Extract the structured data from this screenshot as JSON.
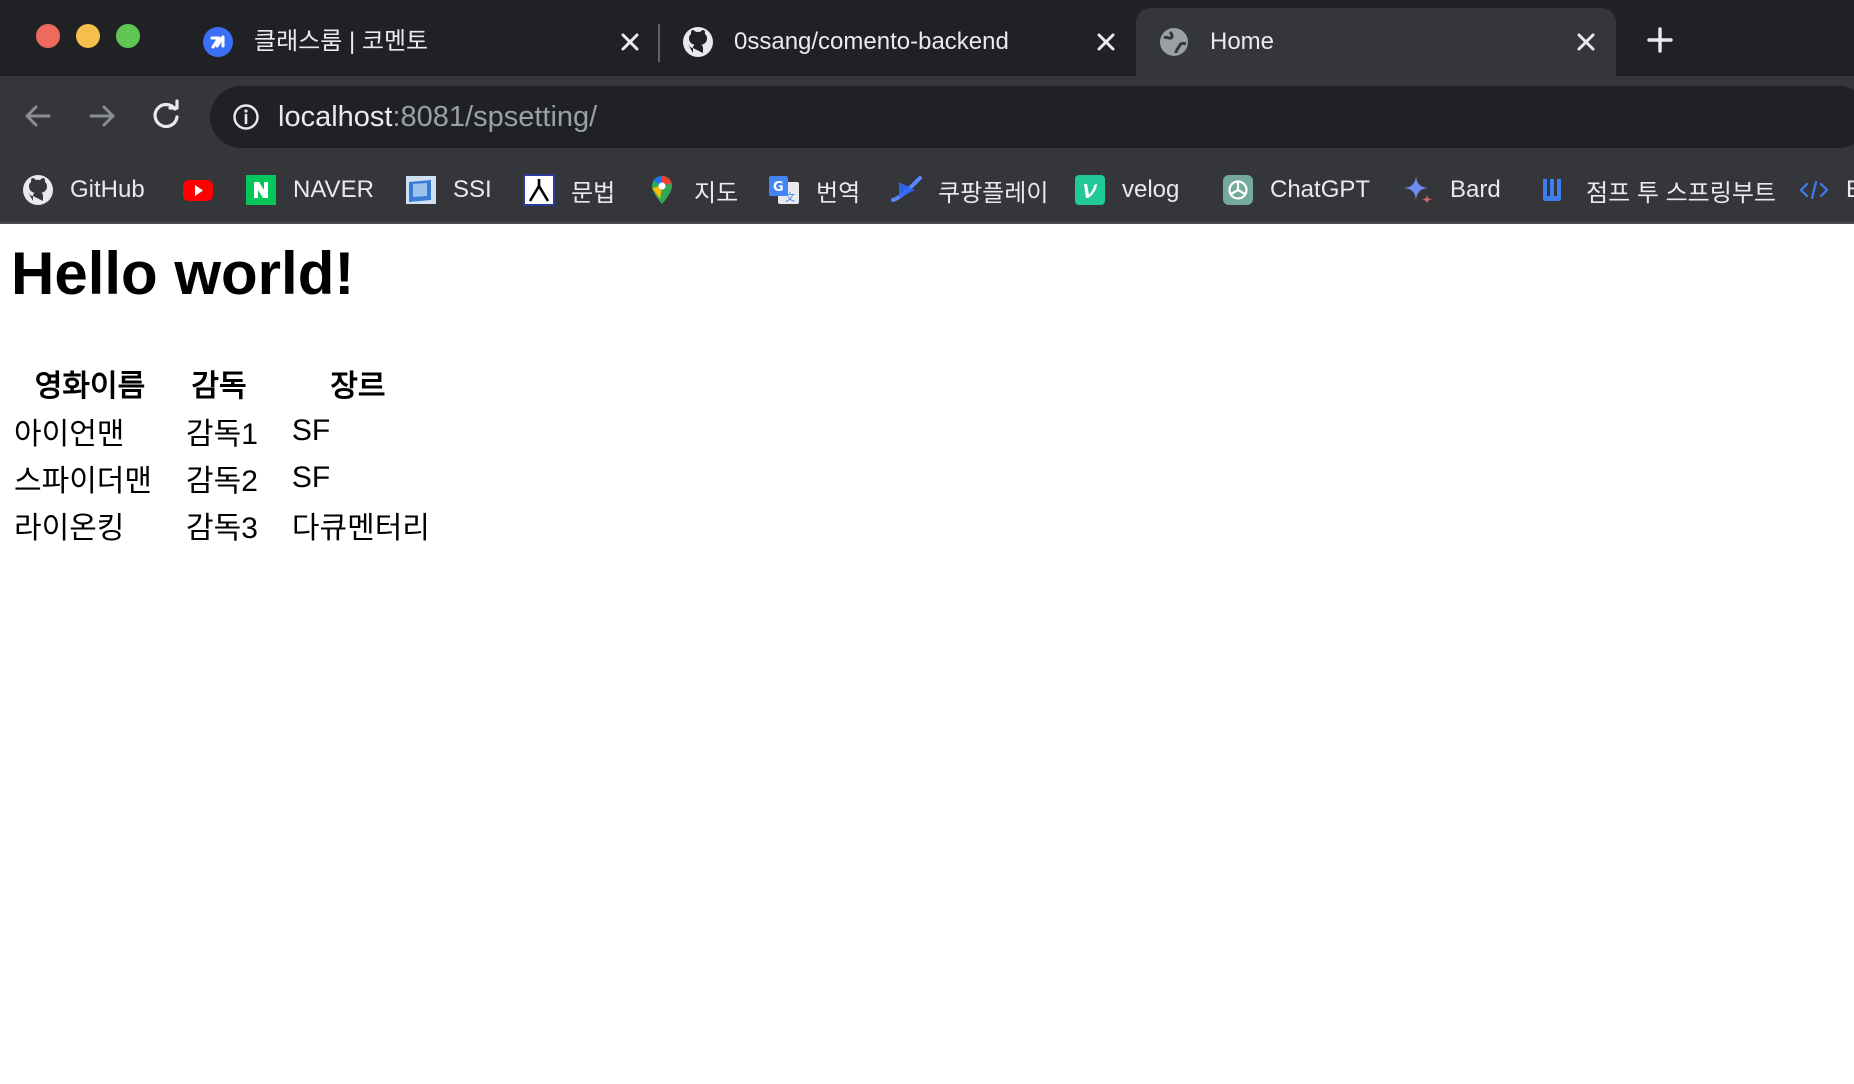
{
  "browser": {
    "tabs": [
      {
        "title": "클래스룸 | 코멘토",
        "favicon": "comento-icon",
        "active": false
      },
      {
        "title": "0ssang/comento-backend",
        "favicon": "github-icon",
        "active": false
      },
      {
        "title": "Home",
        "favicon": "globe-icon",
        "active": true
      }
    ],
    "address": {
      "host": "localhost",
      "rest": ":8081/spsetting/"
    },
    "bookmarks": [
      {
        "label": "GitHub",
        "icon": "github-icon"
      },
      {
        "label": "",
        "icon": "youtube-icon"
      },
      {
        "label": "NAVER",
        "icon": "naver-icon"
      },
      {
        "label": "SSI",
        "icon": "ssi-icon"
      },
      {
        "label": "문법",
        "icon": "grammar-icon"
      },
      {
        "label": "지도",
        "icon": "maps-icon"
      },
      {
        "label": "번역",
        "icon": "translate-icon"
      },
      {
        "label": "쿠팡플레이",
        "icon": "coupang-play-icon"
      },
      {
        "label": "velog",
        "icon": "velog-icon"
      },
      {
        "label": "ChatGPT",
        "icon": "chatgpt-icon"
      },
      {
        "label": "Bard",
        "icon": "bard-icon"
      },
      {
        "label": "점프 투 스프링부트",
        "icon": "wikidocs-icon"
      },
      {
        "label": "E",
        "icon": "code-icon"
      }
    ],
    "colors": {
      "frame": "#202124",
      "toolbar": "#35363a",
      "text": "#e8eaed"
    }
  },
  "page": {
    "heading": "Hello world!",
    "table": {
      "headers": [
        "영화이름",
        "감독",
        "장르"
      ],
      "rows": [
        [
          "아이언맨",
          "감독1",
          "SF"
        ],
        [
          "스파이더맨",
          "감독2",
          "SF"
        ],
        [
          "라이온킹",
          "감독3",
          "다큐멘터리"
        ]
      ]
    }
  }
}
